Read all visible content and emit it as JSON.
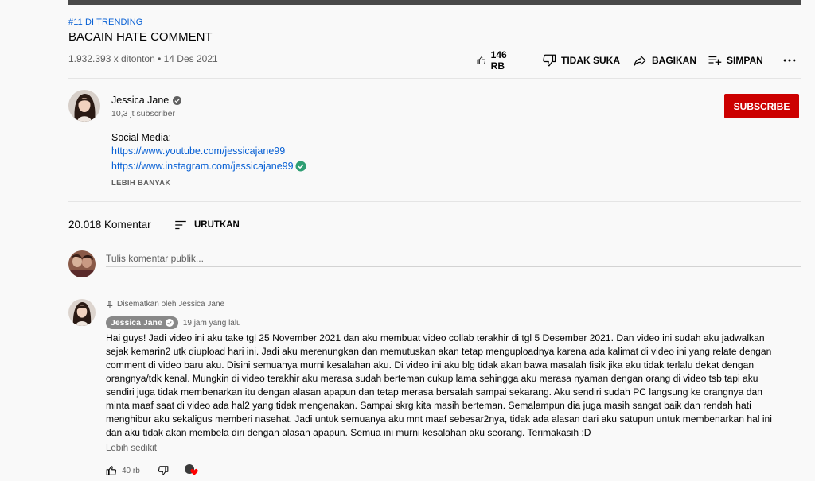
{
  "video": {
    "hashtag": "#11 DI TRENDING",
    "title": "BACAIN HATE COMMENT",
    "views_date": "1.932.393 x ditonton • 14 Des 2021"
  },
  "actions": {
    "like": "146 RB",
    "dislike": "TIDAK SUKA",
    "share": "BAGIKAN",
    "save": "SIMPAN"
  },
  "channel": {
    "name": "Jessica Jane",
    "subscribers": "10,3 jt subscriber",
    "subscribe_label": "SUBSCRIBE"
  },
  "description": {
    "label": "Social Media:",
    "link1": "https://www.youtube.com/jessicajane99",
    "link2": "https://www.instagram.com/jessicajane99",
    "more": "LEBIH BANYAK"
  },
  "comments": {
    "count": "20.018 Komentar",
    "sort_label": "URUTKAN",
    "input_placeholder": "Tulis komentar publik...",
    "pinned": {
      "pinned_label": "Disematkan oleh Jessica Jane",
      "author": "Jessica Jane",
      "time": "19 jam yang lalu",
      "text": "Hai guys! Jadi video ini aku take tgl 25 November 2021 dan aku membuat video collab terakhir di tgl 5 Desember 2021. Dan video ini sudah aku jadwalkan sejak kemarin2 utk diupload hari ini. Jadi aku merenungkan dan memutuskan akan tetap menguploadnya karena ada kalimat di video ini yang relate dengan comment di video baru aku. Disini semuanya murni kesalahan aku. Di video ini aku blg tidak akan bawa masalah fisik jika aku tidak terlalu dekat dengan orangnya/tdk kenal. Mungkin di video terakhir aku merasa sudah berteman cukup lama sehingga aku merasa nyaman dengan orang di video tsb tapi aku sendiri juga tidak membenarkan itu dengan alasan apapun dan tetap merasa bersalah sampai sekarang. Aku sendiri sudah PC langsung ke orangnya dan minta maaf saat di video ada hal2 yang tidak mengenakan. Sampai skrg kita masih berteman. Semalampun dia juga masih sangat baik dan rendah hati menghibur aku sekaligus memberi nasehat. Jadi untuk semuanya aku mnt maaf sebesar2nya, tidak ada alasan dari aku satupun untuk membenarkan hal ini dan aku tidak akan membela diri dengan alasan apapun. Semua ini murni kesalahan aku seorang. Terimakasih :D",
      "show_less": "Lebih sedikit",
      "likes": "40 rb"
    }
  },
  "colors": {
    "subscribe": "#cc0000",
    "link": "#065fd4",
    "secondary_text": "#606060",
    "author_chip": "#888888",
    "heart": "#ff0000"
  }
}
